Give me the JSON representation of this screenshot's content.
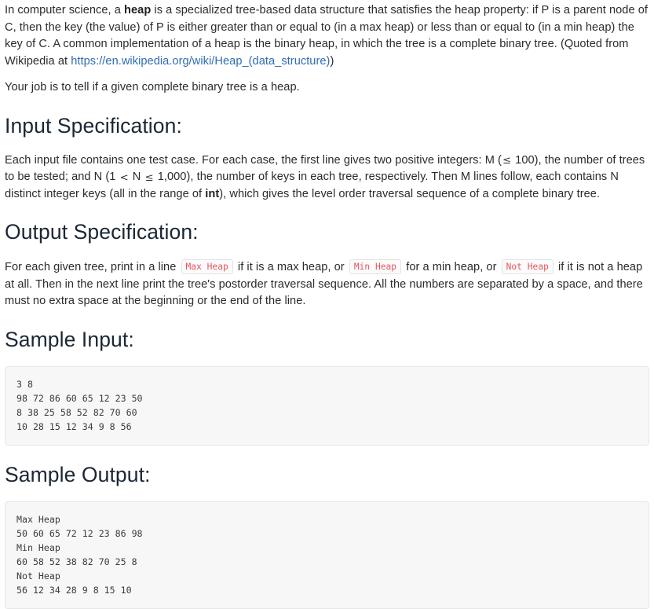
{
  "intro": {
    "segments": {
      "s1": "In computer science, a ",
      "bold1": "heap",
      "s2": " is a specialized tree-based data structure that satisfies the heap property: if P is a parent node of C, then the key (the value) of P is either greater than or equal to (in a max heap) or less than or equal to (in a min heap) the key of C. A common implementation of a heap is the binary heap, in which the tree is a complete binary tree. (Quoted from Wikipedia at ",
      "link": "https://en.wikipedia.org/wiki/Heap_(data_structure)",
      "s3": ")"
    },
    "job": "Your job is to tell if a given complete binary tree is a heap."
  },
  "input_spec": {
    "heading": "Input Specification:",
    "t1": "Each input file contains one test case. For each case, the first line gives two positive integers: M (",
    "le1": "≤",
    "t2": " 100), the number of trees to be tested; and N (1 ",
    "lt1": "<",
    "t3": " N ",
    "le2": "≤",
    "t4": " 1,000), the number of keys in each tree, respectively. Then M lines follow, each contains N distinct integer keys (all in the range of ",
    "bold_int": "int",
    "t5": "), which gives the level order traversal sequence of a complete binary tree."
  },
  "output_spec": {
    "heading": "Output Specification:",
    "t1": "For each given tree, print in a line ",
    "code_max": "Max Heap",
    "t2": " if it is a max heap, or ",
    "code_min": "Min Heap",
    "t3": " for a min heap, or ",
    "code_not": "Not Heap",
    "t4": " if it is not a heap at all. Then in the next line print the tree's postorder traversal sequence. All the numbers are separated by a space, and there must no extra space at the beginning or the end of the line."
  },
  "sample_input": {
    "heading": "Sample Input:",
    "code": "3 8\n98 72 86 60 65 12 23 50\n8 38 25 58 52 82 70 60\n10 28 15 12 34 9 8 56"
  },
  "sample_output": {
    "heading": "Sample Output:",
    "code": "Max Heap\n50 60 65 72 12 23 86 98\nMin Heap\n60 58 52 38 82 70 25 8\nNot Heap\n56 12 34 28 9 8 15 10"
  },
  "colors": {
    "link": "#2f6cb3",
    "code_text": "#e8545f",
    "code_bg": "#f7f7f7",
    "code_border": "#e6e6e6",
    "body_text": "#2b2b2b",
    "heading_text": "#1b2733"
  }
}
